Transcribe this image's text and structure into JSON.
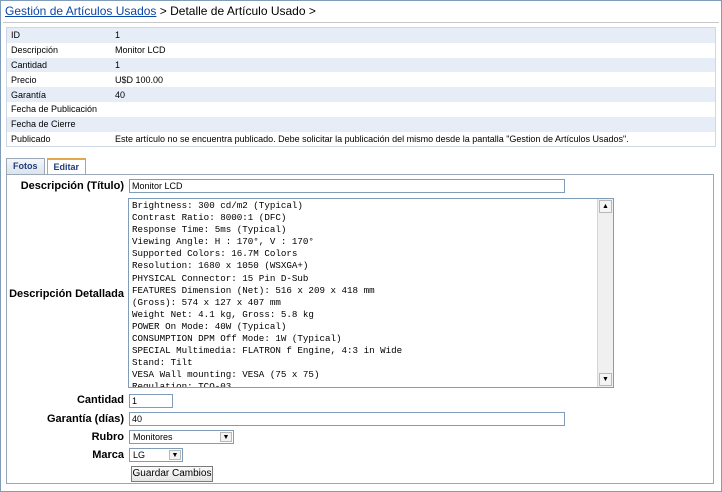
{
  "breadcrumb": {
    "link": "Gestión de Artículos Usados",
    "sep": " > ",
    "current": "Detalle de Artículo Usado >"
  },
  "info": [
    {
      "label": "ID",
      "value": "1"
    },
    {
      "label": "Descripción",
      "value": "Monitor LCD"
    },
    {
      "label": "Cantidad",
      "value": "1"
    },
    {
      "label": "Precio",
      "value": "U$D 100.00"
    },
    {
      "label": "Garantía",
      "value": "40"
    },
    {
      "label": "Fecha de Publicación",
      "value": ""
    },
    {
      "label": "Fecha de Cierre",
      "value": ""
    },
    {
      "label": "Publicado",
      "value": "Este artículo no se encuentra publicado. Debe solicitar la publicación del mismo desde la pantalla \"Gestion de Artículos Usados\"."
    }
  ],
  "tabs": {
    "fotos": "Fotos",
    "editar": "Editar"
  },
  "form": {
    "desc_title_label": "Descripción (Título)",
    "desc_title_value": "Monitor LCD",
    "desc_detail_label": "Descripción Detallada",
    "desc_detail_value": "Brightness: 300 cd/m2 (Typical)\nContrast Ratio: 8000:1 (DFC)\nResponse Time: 5ms (Typical)\nViewing Angle: H : 170°, V : 170°\nSupported Colors: 16.7M Colors\nResolution: 1680 x 1050 (WSXGA+)\nPHYSICAL Connector: 15 Pin D-Sub\nFEATURES Dimension (Net): 516 x 209 x 418 mm\n(Gross): 574 x 127 x 407 mm\nWeight Net: 4.1 kg, Gross: 5.8 kg\nPOWER On Mode: 40W (Typical)\nCONSUMPTION DPM Off Mode: 1W (Typical)\nSPECIAL Multimedia: FLATRON f Engine, 4:3 in Wide\nStand: Tilt\nVESA Wall mounting: VESA (75 x 75)\nRegulation: TCO-03",
    "cantidad_label": "Cantidad",
    "cantidad_value": "1",
    "garantia_label": "Garantía (días)",
    "garantia_value": "40",
    "rubro_label": "Rubro",
    "rubro_value": "Monitores",
    "marca_label": "Marca",
    "marca_value": "LG",
    "save_label": "Guardar Cambios"
  },
  "icons": {
    "dropdown": "chevron-down-icon",
    "scroll_up": "arrow-up-icon",
    "scroll_down": "arrow-down-icon"
  }
}
